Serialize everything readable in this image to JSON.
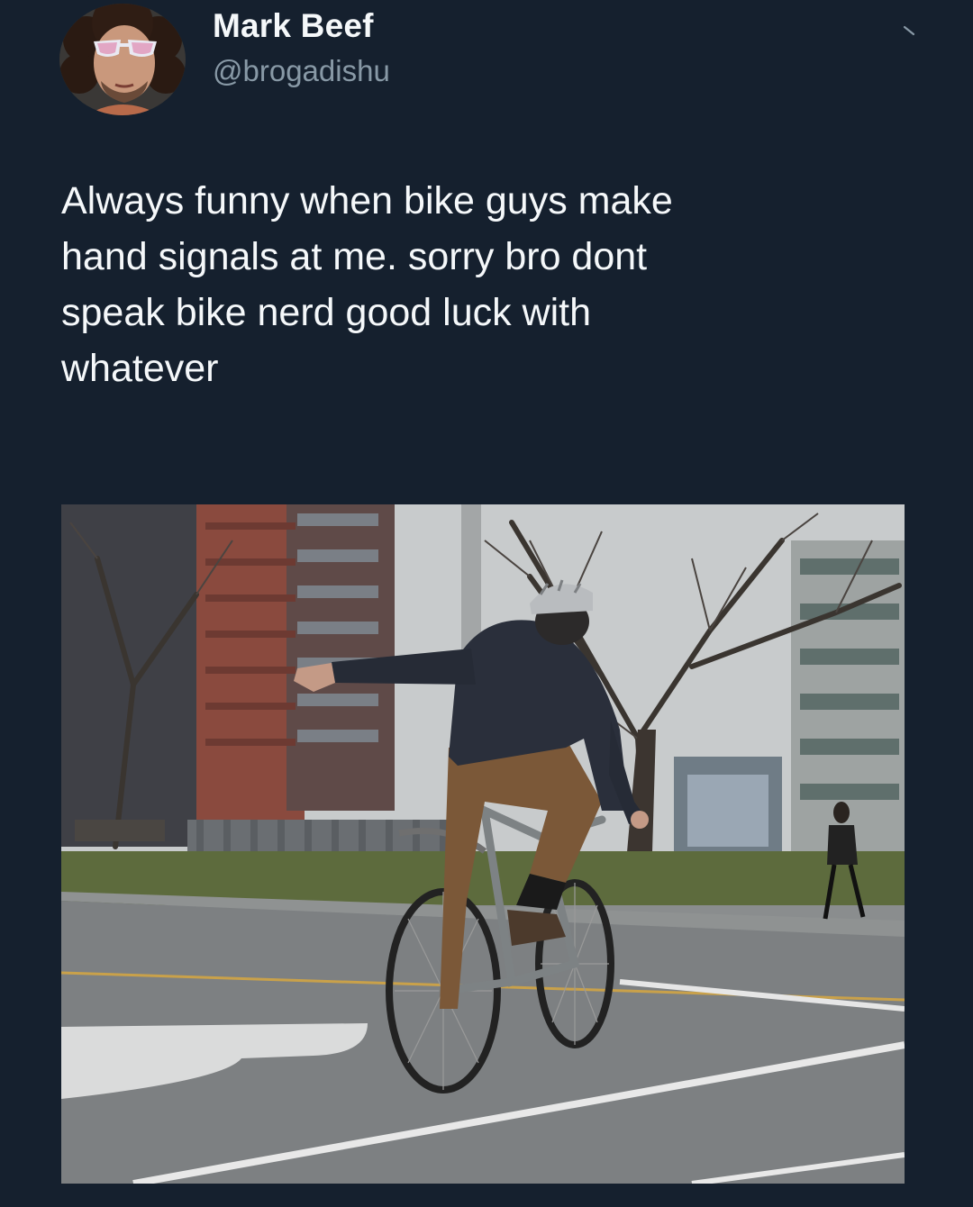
{
  "author": {
    "display_name": "Mark Beef",
    "handle": "@brogadishu"
  },
  "tweet": {
    "text": "Always funny when bike guys make\nhand signals at me. sorry bro dont\nspeak bike nerd good luck with\nwhatever"
  },
  "icons": {
    "avatar": "profile-photo",
    "menu": "chevron-down-icon"
  },
  "colors": {
    "background": "#15202e",
    "text": "#f5f8fa",
    "secondary_text": "#8899a6"
  }
}
